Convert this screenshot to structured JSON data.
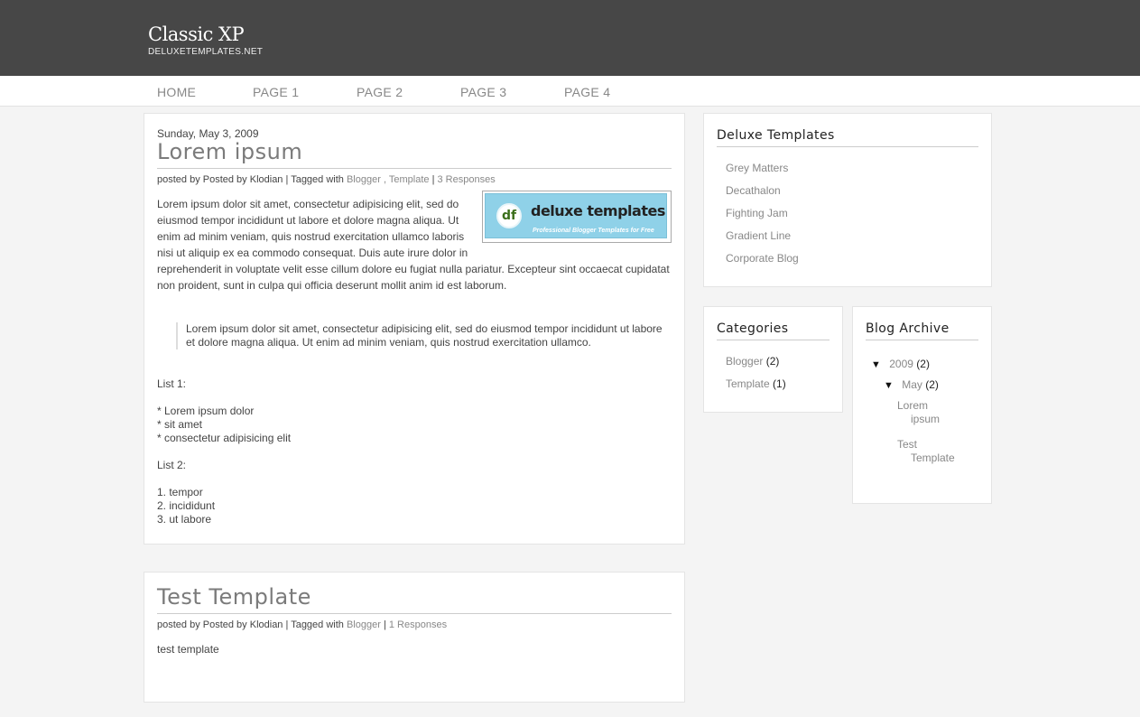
{
  "header": {
    "site_title": "Classic XP",
    "site_subtitle": "DELUXETEMPLATES.NET"
  },
  "nav": {
    "items": [
      "HOME",
      "PAGE 1",
      "PAGE 2",
      "PAGE 3",
      "PAGE 4"
    ]
  },
  "posts": [
    {
      "date": "Sunday, May 3, 2009",
      "title": "Lorem ipsum",
      "meta": {
        "posted_by": "posted by Posted by Klodian | Tagged with",
        "tags": [
          "Blogger",
          "Template"
        ],
        "tag_separator": ",",
        "bar": "|",
        "responses": "3 Responses"
      },
      "banner": {
        "logo_letters": "df",
        "brand": "deluxe templates",
        "tagline": "Professional Blogger Templates for Free"
      },
      "paragraph": "Lorem ipsum dolor sit amet, consectetur adipisicing elit, sed do eiusmod tempor incididunt ut labore et dolore magna aliqua. Ut enim ad minim veniam, quis nostrud exercitation ullamco laboris nisi ut aliquip ex ea commodo consequat. Duis aute irure dolor in reprehenderit in voluptate velit esse cillum dolore eu fugiat nulla pariatur. Excepteur sint occaecat cupidatat non proident, sunt in culpa qui officia deserunt mollit anim id est laborum.",
      "blockquote": "Lorem ipsum dolor sit amet, consectetur adipisicing elit, sed do eiusmod tempor incididunt ut labore et dolore magna aliqua. Ut enim ad minim veniam, quis nostrud exercitation ullamco.",
      "list1_label": "List 1:",
      "list1": [
        "* Lorem ipsum dolor",
        "* sit amet",
        "* consectetur adipisicing elit"
      ],
      "list2_label": "List 2:",
      "list2": [
        "1. tempor",
        "2. incididunt",
        "3. ut labore"
      ]
    },
    {
      "title": "Test Template",
      "meta": {
        "posted_by": "posted by Posted by Klodian | Tagged with",
        "tags": [
          "Blogger"
        ],
        "bar": "|",
        "responses": "1 Responses"
      },
      "body": "test template"
    }
  ],
  "sidebar": {
    "deluxe": {
      "title": "Deluxe Templates",
      "links": [
        "Grey Matters",
        "Decathalon",
        "Fighting Jam",
        "Gradient Line",
        "Corporate Blog"
      ]
    },
    "categories": {
      "title": "Categories",
      "items": [
        {
          "label": "Blogger",
          "count": "(2)"
        },
        {
          "label": "Template",
          "count": "(1)"
        }
      ]
    },
    "archive": {
      "title": "Blog Archive",
      "triangle": "▼",
      "year": {
        "label": "2009",
        "count": "(2)"
      },
      "month": {
        "label": "May",
        "count": "(2)"
      },
      "posts": [
        {
          "line1": "Lorem",
          "line2": "ipsum"
        },
        {
          "line1": "Test",
          "line2": "Template"
        }
      ]
    }
  }
}
